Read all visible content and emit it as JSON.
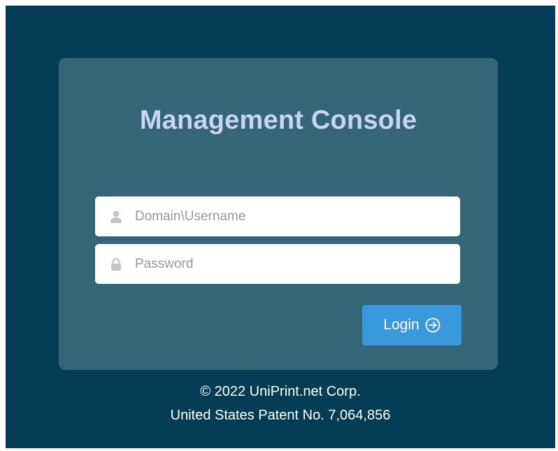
{
  "panel": {
    "title": "Management Console"
  },
  "form": {
    "username": {
      "placeholder": "Domain\\Username",
      "value": "",
      "icon": "user-icon"
    },
    "password": {
      "placeholder": "Password",
      "value": "",
      "icon": "lock-icon"
    },
    "login_label": "Login",
    "login_icon": "circle-arrow-right-icon"
  },
  "footer": {
    "copyright": "© 2022 UniPrint.net Corp.",
    "patent": "United States Patent No. 7,064,856"
  },
  "colors": {
    "background": "#053d57",
    "panel": "#346678",
    "title": "#c6d5f5",
    "button": "#3a98dd"
  }
}
